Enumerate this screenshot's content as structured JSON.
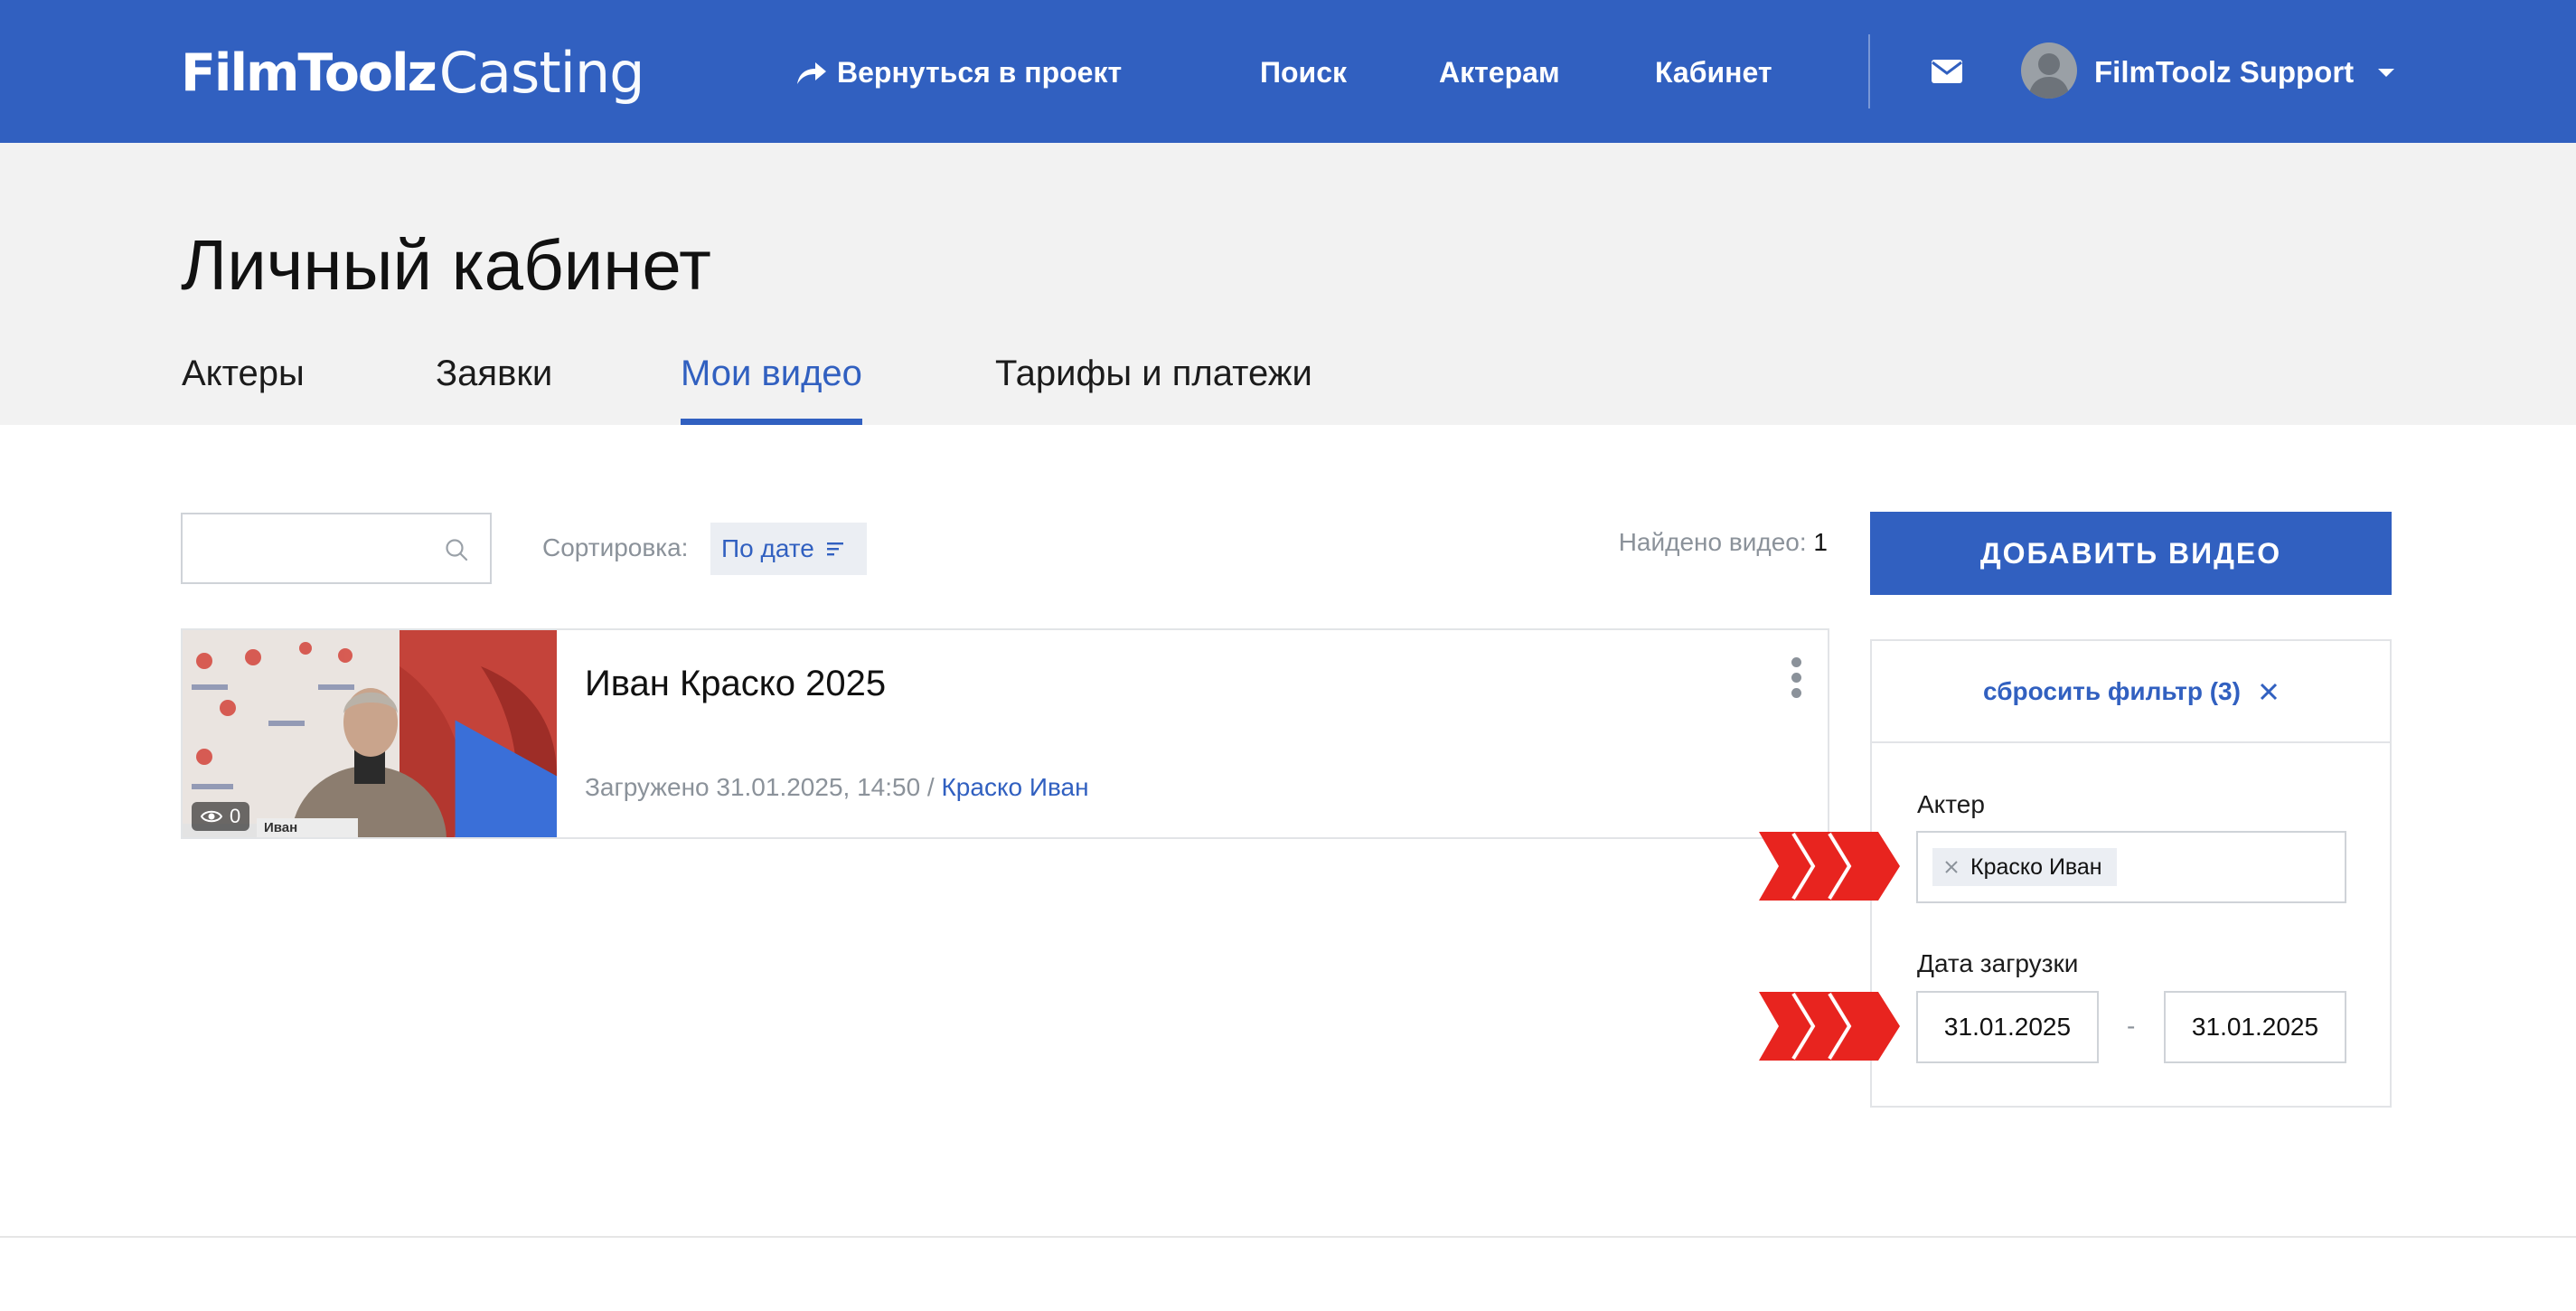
{
  "header": {
    "logo_bold": "FilmToolz",
    "logo_light": "Casting",
    "back_link": "Вернуться в проект",
    "nav": {
      "search": "Поиск",
      "actors": "Актерам",
      "cabinet": "Кабинет"
    },
    "user_name": "FilmToolz Support"
  },
  "page": {
    "title": "Личный кабинет",
    "tabs": [
      {
        "label": "Актеры",
        "active": false
      },
      {
        "label": "Заявки",
        "active": false
      },
      {
        "label": "Мои видео",
        "active": true
      },
      {
        "label": "Тарифы и платежи",
        "active": false
      }
    ]
  },
  "toolbar": {
    "search_placeholder": "",
    "sort_label": "Сортировка:",
    "sort_value": "По дате",
    "found_label": "Найдено видео:",
    "found_count": "1"
  },
  "videos": [
    {
      "title": "Иван Краско 2025",
      "uploaded": "Загружено 31.01.2025, 14:50 /",
      "actor": "Краско Иван",
      "views": "0",
      "name_plate": "Иван"
    }
  ],
  "sidebar": {
    "add_button": "ДОБАВИТЬ ВИДЕО",
    "reset_filter": "сбросить фильтр (3)",
    "actor_label": "Актер",
    "actor_chip": "Краско Иван",
    "date_label": "Дата загрузки",
    "date_from": "31.01.2025",
    "date_to": "31.01.2025",
    "date_dash": "-"
  },
  "colors": {
    "brand_blue": "#3160c0",
    "header_gray": "#f2f2f2",
    "marker_red": "#e8241f"
  }
}
